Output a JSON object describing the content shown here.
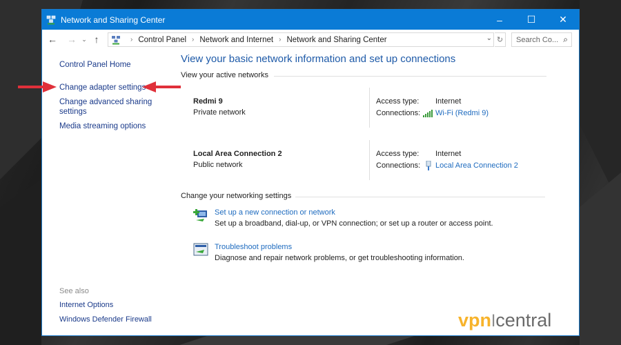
{
  "window": {
    "title": "Network and Sharing Center",
    "controls": {
      "minimize": "–",
      "maximize": "☐",
      "close": "✕"
    }
  },
  "address": {
    "back": "←",
    "forward": "→",
    "recent": "⌄",
    "up": "↑",
    "crumbs": [
      "Control Panel",
      "Network and Internet",
      "Network and Sharing Center"
    ],
    "dropdown": "⌄",
    "refresh": "↻",
    "search_placeholder": "Search Co...",
    "search_icon": "⚲"
  },
  "sidebar": {
    "items": [
      {
        "label": "Control Panel Home"
      },
      {
        "label": "Change adapter settings"
      },
      {
        "label": "Change advanced sharing settings"
      },
      {
        "label": "Media streaming options"
      }
    ],
    "see_also_header": "See also",
    "see_also": [
      {
        "label": "Internet Options"
      },
      {
        "label": "Windows Defender Firewall"
      }
    ]
  },
  "main": {
    "title": "View your basic network information and set up connections",
    "active_header": "View your active networks",
    "networks": [
      {
        "name": "Redmi 9",
        "type": "Private network",
        "access_label": "Access type:",
        "access": "Internet",
        "conn_label": "Connections:",
        "conn": "Wi-Fi (Redmi 9)",
        "conn_icon": "wifi-signal-icon"
      },
      {
        "name": "Local Area Connection 2",
        "type": "Public network",
        "access_label": "Access type:",
        "access": "Internet",
        "conn_label": "Connections:",
        "conn": "Local Area Connection 2",
        "conn_icon": "ethernet-icon"
      }
    ],
    "settings_header": "Change your networking settings",
    "tasks": [
      {
        "label": "Set up a new connection or network",
        "desc": "Set up a broadband, dial-up, or VPN connection; or set up a router or access point.",
        "icon": "new-connection-icon"
      },
      {
        "label": "Troubleshoot problems",
        "desc": "Diagnose and repair network problems, or get troubleshooting information.",
        "icon": "troubleshoot-icon"
      }
    ]
  },
  "annotation": {
    "color": "#e0303a"
  },
  "watermark": {
    "vpn": "vpn",
    "central": "central"
  },
  "colors": {
    "titlebar": "#0a7bd6",
    "link": "#1e6bbf",
    "sidebar_link": "#1a3a8a",
    "heading": "#1e5aa8"
  }
}
